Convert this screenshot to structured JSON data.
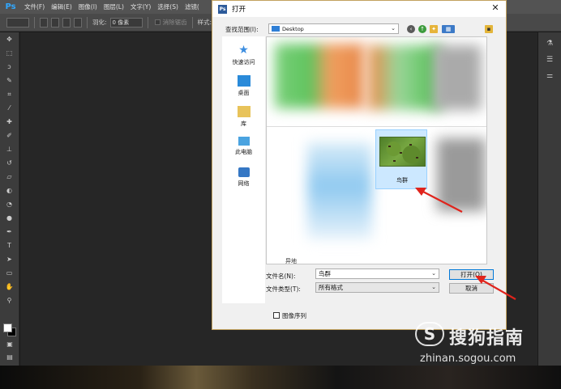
{
  "app": {
    "logo": "Ps",
    "menu": [
      "文件(F)",
      "编辑(E)",
      "图像(I)",
      "图层(L)",
      "文字(Y)",
      "选择(S)",
      "滤镜("
    ],
    "options": {
      "feather_label": "羽化:",
      "feather_value": "0 像素",
      "antialias_label": "消除锯齿",
      "style_label": "样式:"
    }
  },
  "dialog": {
    "title": "打开",
    "look_in_label": "查找范围(I):",
    "look_in_value": "Desktop",
    "places": [
      {
        "label": "快速访问",
        "icon": "star-icon"
      },
      {
        "label": "桌面",
        "icon": "desktop-icon"
      },
      {
        "label": "库",
        "icon": "library-icon"
      },
      {
        "label": "此电脑",
        "icon": "computer-icon"
      },
      {
        "label": "网络",
        "icon": "network-icon"
      }
    ],
    "selected_file": "鸟群",
    "partial_file_label": "异地",
    "filename_label": "文件名(N):",
    "filename_value": "鸟群",
    "filetype_label": "文件类型(T):",
    "filetype_value": "所有格式",
    "open_button": "打开(O)",
    "cancel_button": "取消",
    "sequence_label": "图像序列"
  },
  "watermark": {
    "logo": "S",
    "title": "搜狗指南",
    "url": "zhinan.sogou.com"
  },
  "colors": {
    "accent": "#0078d7",
    "selection": "#cce8ff",
    "arrow": "#e0241c",
    "dialog_border": "#c2a15e"
  }
}
